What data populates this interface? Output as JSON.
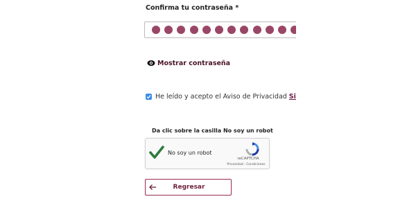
{
  "confirm_password": {
    "label": "Confirma tu contraseña *",
    "masked_value": "●●●●●●●●●●●●"
  },
  "show_password": {
    "label": "Mostrar contraseña",
    "icon": "eye-icon"
  },
  "privacy": {
    "checked": true,
    "text": "He leído y acepto el Aviso de Privacidad",
    "link": "Simpl"
  },
  "captcha": {
    "instruction": "Da clic sobre la casilla No soy un robot",
    "label": "No soy un robot",
    "checked": true,
    "brand": "reCAPTCHA",
    "terms": "Privacidad - Condiciones"
  },
  "back_button": {
    "label": "Regresar"
  },
  "colors": {
    "dot": "#9a4666",
    "accent": "#6b1e3a",
    "checkbox": "#3b8ee8",
    "captcha_check": "#2d7a3e"
  }
}
